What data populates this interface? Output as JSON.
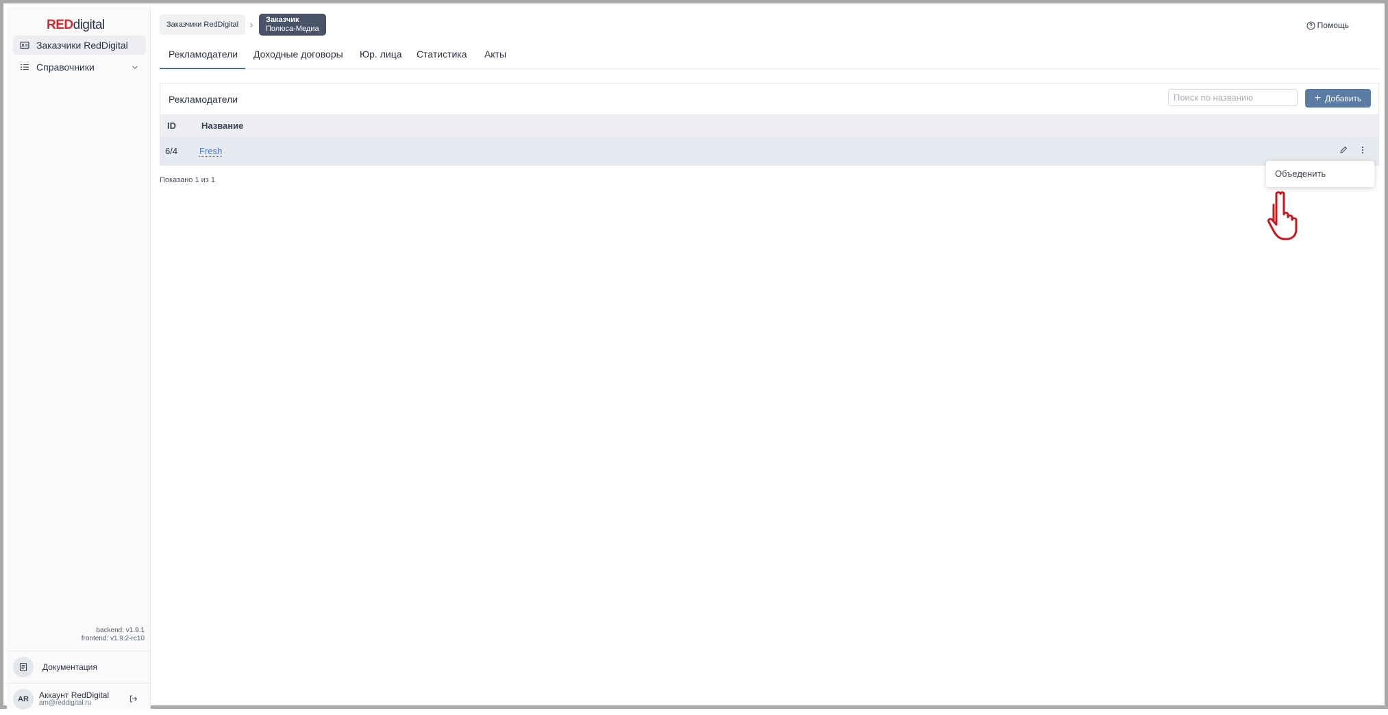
{
  "brand": {
    "part_red": "RED",
    "part_dark": "digital",
    "accent": "#e0242b"
  },
  "sidebar": {
    "items": [
      {
        "label": "Заказчики RedDigital",
        "icon": "contact-card-icon",
        "active": true
      },
      {
        "label": "Справочники",
        "icon": "list-icon",
        "expandable": true
      }
    ],
    "versions": {
      "backend": "backend: v1.9.1",
      "frontend": "frontend: v1.9.2-rc10"
    },
    "docs_label": "Документация",
    "account": {
      "initials": "AR",
      "name": "Аккаунт RedDigital",
      "email": "am@reddigital.ru"
    }
  },
  "breadcrumb": {
    "first": "Заказчики RedDigital",
    "current_title": "Заказчик",
    "current_subtitle": "Полюса-Медиа"
  },
  "help_label": "Помощь",
  "tabs": [
    {
      "label": "Рекламодатели",
      "active": true
    },
    {
      "label": "Доходные договоры"
    },
    {
      "label": "Юр. лица"
    },
    {
      "label": "Статистика"
    },
    {
      "label": "Акты"
    }
  ],
  "panel": {
    "title": "Рекламодатели",
    "search_placeholder": "Поиск по названию",
    "add_label": "Добавить",
    "columns": [
      "ID",
      "Название"
    ],
    "rows": [
      {
        "id": "6/4",
        "name": "Fresh"
      }
    ],
    "shown": "Показано 1 из 1"
  },
  "row_menu": {
    "items": [
      "Объеденить"
    ]
  },
  "colors": {
    "primary": "#5b7ca4",
    "link": "#4a7bbf",
    "breadcrumb_active": "#4a5468"
  }
}
